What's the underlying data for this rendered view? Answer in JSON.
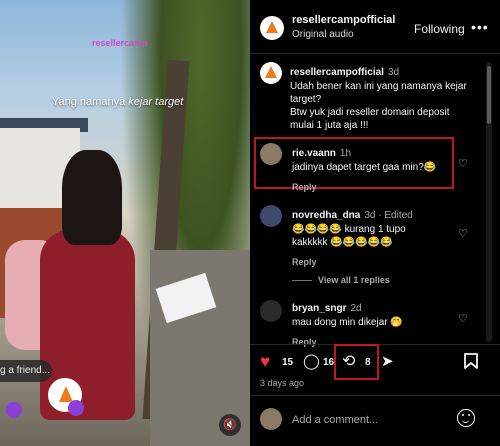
{
  "video": {
    "watermark": "resellercamp",
    "overlay_prefix": "Yang namanya ",
    "overlay_emphasis": "kejar target",
    "tag_friend": "g a friend...",
    "mute_icon": "speaker-muted-icon"
  },
  "header": {
    "username": "resellercampofficial",
    "subtitle": "Original audio",
    "follow_label": "Following",
    "more_icon": "more-icon"
  },
  "comments": [
    {
      "username": "resellercampofficial",
      "time": "3d",
      "lines": [
        "Udah bener kan ini yang namanya kejar",
        "target?",
        "Btw yuk jadi reseller domain deposit",
        "mulai 1 juta aja !!!"
      ]
    },
    {
      "username": "rie.vaann",
      "time": "1h",
      "lines": [
        "jadinya dapet target gaa min?😂"
      ],
      "reply": "Reply"
    },
    {
      "username": "novredha_dna",
      "time": "3d · Edited",
      "lines": [
        "😂😂😂😂 kurang 1 tupo",
        "kakkkkk 😂😂😂😂😂"
      ],
      "reply": "Reply",
      "view_replies": "View all 1 replies"
    },
    {
      "username": "bryan_sngr",
      "time": "2d",
      "lines": [
        "mau dong min dikejar 🤭"
      ],
      "reply": "Reply"
    }
  ],
  "actions": {
    "likes": "15",
    "comments": "16",
    "reposts": "8",
    "date": "3 days ago",
    "like_color": "#ff3040"
  },
  "composer": {
    "placeholder": "Add a comment..."
  },
  "colors": {
    "highlight": "#c0161e",
    "accent_orange": "#f07b1f"
  }
}
